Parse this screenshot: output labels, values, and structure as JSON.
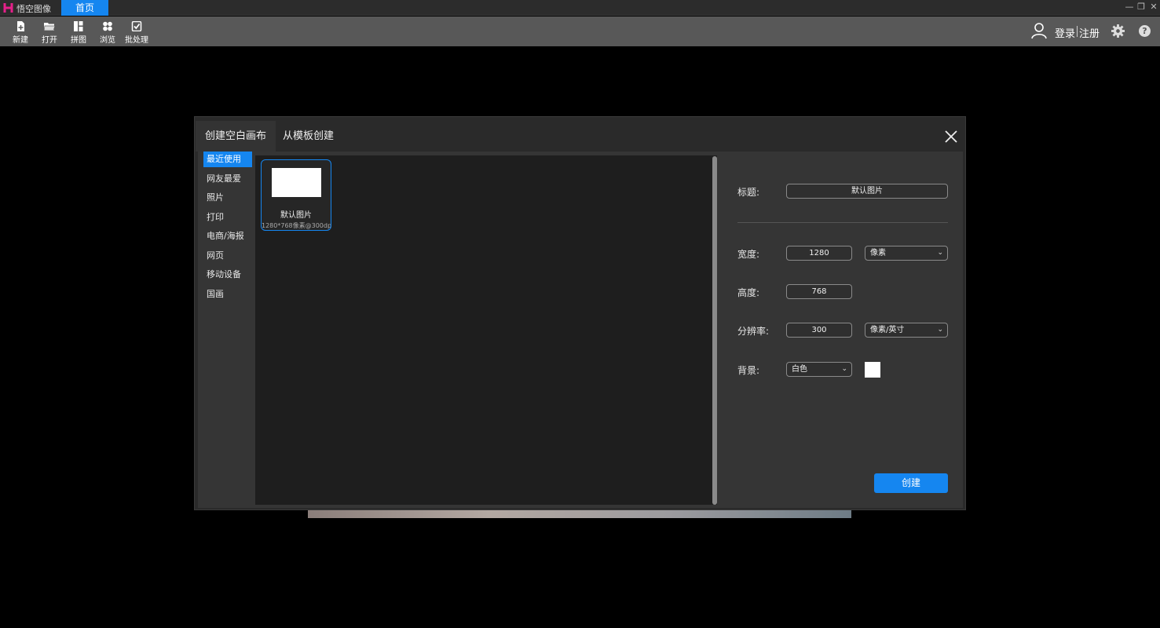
{
  "titlebar": {
    "app_name": "悟空图像",
    "home_tab": "首页",
    "logo_letter": "H"
  },
  "toolbar": {
    "items": [
      {
        "label": "新建",
        "icon": "new-file-icon"
      },
      {
        "label": "打开",
        "icon": "folder-open-icon"
      },
      {
        "label": "拼图",
        "icon": "collage-icon"
      },
      {
        "label": "浏览",
        "icon": "browse-icon"
      },
      {
        "label": "批处理",
        "icon": "batch-icon"
      }
    ],
    "login": "登录",
    "register": "注册",
    "help": "?"
  },
  "dialog": {
    "tabs": [
      "创建空白画布",
      "从模板创建"
    ],
    "categories": [
      "最近使用",
      "网友最爱",
      "照片",
      "打印",
      "电商/海报",
      "网页",
      "移动设备",
      "国画"
    ],
    "template": {
      "name": "默认图片",
      "spec": "1280*768像素@300dpi"
    },
    "props": {
      "title_label": "标题:",
      "title_value": "默认图片",
      "width_label": "宽度:",
      "width_value": "1280",
      "width_unit": "像素",
      "height_label": "高度:",
      "height_value": "768",
      "res_label": "分辨率:",
      "res_value": "300",
      "res_unit": "像素/英寸",
      "bg_label": "背景:",
      "bg_value": "白色",
      "create": "创建"
    }
  },
  "colors": {
    "accent": "#1586f0"
  }
}
